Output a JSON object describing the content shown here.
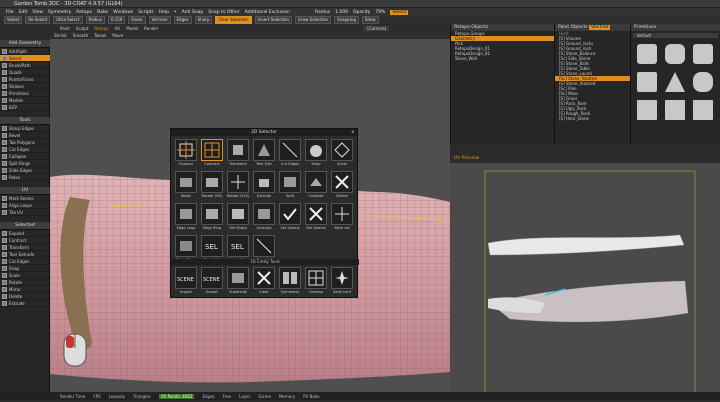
{
  "window": {
    "title": "Garden Tomb.3DC - 3D-COAT 4.9.57 (GL64)",
    "controls": [
      "–",
      "❐",
      "✕"
    ]
  },
  "menu": [
    "File",
    "Edit",
    "View",
    "Symmetry",
    "Retopo",
    "Bake",
    "Windows",
    "Scripts",
    "Help",
    "•",
    "Anti Snap",
    "Snap to Other",
    "Additional Exclusion"
  ],
  "menu_tail": [
    "Radius",
    "1.000",
    "Opacity",
    "79%"
  ],
  "menu_highlight": "Select",
  "toolbar": [
    "Select",
    "Re-Select",
    "Ultra Select",
    "Radius",
    "0.156",
    "Faces",
    "Vertices",
    "Edges",
    "Sharp",
    "Clear Selection",
    "Invert Selection",
    "Grow Selection",
    "Snapping",
    "Show"
  ],
  "viewport_tabs": [
    "Paint",
    "Sculpt",
    "Retopo",
    "UV",
    "Model",
    "Render"
  ],
  "viewport_toolbar": [
    "Shrink",
    "Smooth",
    "Tweak",
    "Move"
  ],
  "camera": "[Camera]",
  "left_panel": {
    "sections": [
      {
        "title": "Add Geometry",
        "items": [
          "Add/Split",
          "Select",
          "Brush/Path",
          "Quads",
          "Points/Faces",
          "Strokes",
          "Primitives",
          "Models",
          "BZP"
        ]
      },
      {
        "title": "Tools",
        "items": [
          "Sharp Edges",
          "Bevel",
          "Tab Polygons",
          "Cut Edges",
          "Collapse",
          "Split Rings",
          "Slide Edges",
          "Relax"
        ]
      },
      {
        "title": "UV",
        "items": [
          "Mark Seams",
          "Align Loops",
          "Tile UV"
        ]
      },
      {
        "title": "Selected",
        "items": [
          "Expand",
          "Contract",
          "Transform",
          "Tear Extrude",
          "Cut Edges",
          "Snap",
          "Scale",
          "Rotate",
          "Mirror",
          "Delete",
          "Extrude"
        ]
      }
    ],
    "selected_item": "Select"
  },
  "dialog": {
    "title": "3D Selector",
    "close": "x",
    "rows": [
      [
        "Expand",
        "Contract",
        "Transform",
        "Tear Extr",
        "Cut Edges",
        "Snap",
        "Scale"
      ],
      [
        "Relax",
        "Rotate (VR)",
        "Rotate (XYZ)",
        "Extrude",
        "Split",
        "Collapse",
        "Delete"
      ],
      [
        "Edge Loop",
        "Edge Ring",
        "Set Sharp",
        "Unsharp",
        "Set Seams",
        "Del Seams",
        "Mark sel"
      ],
      [
        "Clear Sharp",
        "Store Sel",
        "Load Sel",
        "Clear Sel"
      ]
    ],
    "sub_title": "3D Entity Tools",
    "tools": [
      "Import",
      "Export",
      "Subdivide",
      "Clear",
      "Symmetry",
      "Unwrap",
      "Save conf"
    ],
    "scene_text": "SCENE",
    "sel_text": "SEL",
    "selected_tool": "Contract"
  },
  "retopo_objects": {
    "title": "Retopo Objects",
    "rows": [
      "Retopo Groups",
      "Geometry",
      "Pick",
      "RetopoDesign_01",
      "RetopoDesign_02",
      "Stone_Wall"
    ],
    "selected": "Geometry"
  },
  "paint_objects": {
    "tabs": [
      "Paint Objects",
      "VoxTree"
    ],
    "search_placeholder": "Hunt",
    "rows": [
      "[S] Volume",
      "[S] Ground_rocks",
      "[S] Ground_rock",
      "[S] Stone_Balance",
      "[Sc] Side_Stone",
      "[S] Stone_Balls",
      "[S] Stone_Table",
      "[S] Stone_Laurel",
      "[Sc] Stone_Vaulted",
      "[S] Stone_Stacked",
      "[Sc] Pine",
      "[Sc] Moss",
      "[S] Grass",
      "[S] Rock_Ram",
      "[S] Ugly_Rock",
      "[S] Rough_Rock",
      "[S] Hero_Stone"
    ],
    "selected": "[Sc] Stone_Vaulted"
  },
  "primitives": {
    "title": "Primitives",
    "dropdown": "default"
  },
  "uv_preview": {
    "title": "UV Preview"
  },
  "status": [
    "Render Time",
    "FPS",
    "Lowpoly",
    "Triangles",
    "UV Points: 4062",
    "Edges",
    "Free",
    "Layer",
    "Gizmo",
    "Memory",
    "PV Bake"
  ],
  "colors": {
    "accent": "#e09020",
    "mesh": "#d9a3a8",
    "background": "#4f4f4f"
  }
}
